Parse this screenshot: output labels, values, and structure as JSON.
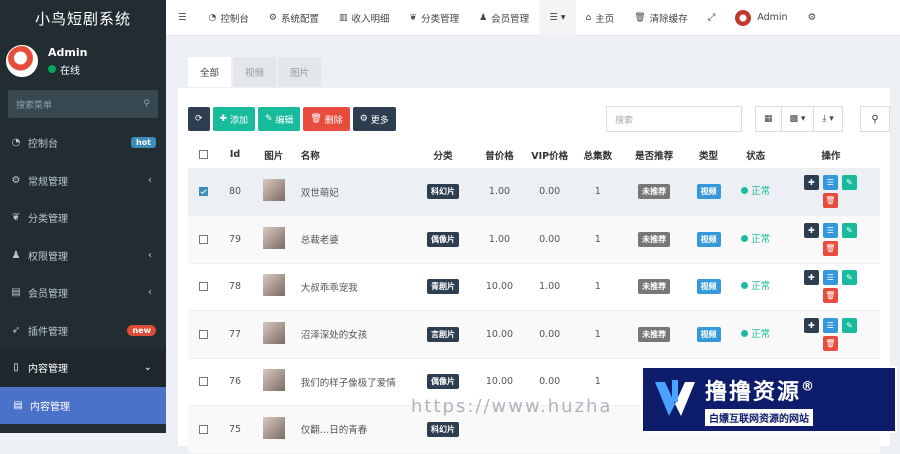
{
  "app": {
    "title": "小鸟短剧系统"
  },
  "user": {
    "name": "Admin",
    "status": "在线"
  },
  "sidebar": {
    "search_placeholder": "搜索菜单",
    "items": [
      {
        "label": "控制台",
        "badge": "hot"
      },
      {
        "label": "常规管理"
      },
      {
        "label": "分类管理"
      },
      {
        "label": "权限管理"
      },
      {
        "label": "会员管理"
      },
      {
        "label": "插件管理",
        "badge": "new"
      },
      {
        "label": "内容管理"
      },
      {
        "label": "内容管理"
      }
    ]
  },
  "topbar": {
    "items": [
      "控制台",
      "系统配置",
      "收入明细",
      "分类管理",
      "会员管理"
    ],
    "home": "主页",
    "clear_cache": "清除缓存",
    "admin": "Admin"
  },
  "tabs": [
    "全部",
    "视频",
    "图片"
  ],
  "toolbar": {
    "add": "添加",
    "edit": "编辑",
    "delete": "删除",
    "more": "更多",
    "search_placeholder": "搜索"
  },
  "table": {
    "headers": [
      "Id",
      "图片",
      "名称",
      "分类",
      "普价格",
      "VIP价格",
      "总集数",
      "是否推荐",
      "类型",
      "状态",
      "操作"
    ],
    "rows": [
      {
        "id": "80",
        "name": "双世萌妃",
        "category": "科幻片",
        "price": "1.00",
        "vip_price": "0.00",
        "episodes": "1",
        "recommend": "未推荐",
        "type": "视频",
        "status": "正常",
        "checked": true
      },
      {
        "id": "79",
        "name": "总裁老婆",
        "category": "偶像片",
        "price": "1.00",
        "vip_price": "0.00",
        "episodes": "1",
        "recommend": "未推荐",
        "type": "视频",
        "status": "正常",
        "checked": false
      },
      {
        "id": "78",
        "name": "大叔乖乖宠我",
        "category": "青剧片",
        "price": "10.00",
        "vip_price": "1.00",
        "episodes": "1",
        "recommend": "未推荐",
        "type": "视频",
        "status": "正常",
        "checked": false
      },
      {
        "id": "77",
        "name": "沼泽深处的女孩",
        "category": "言剧片",
        "price": "10.00",
        "vip_price": "0.00",
        "episodes": "1",
        "recommend": "未推荐",
        "type": "视频",
        "status": "正常",
        "checked": false
      },
      {
        "id": "76",
        "name": "我们的样子像极了爱情",
        "category": "偶像片",
        "price": "10.00",
        "vip_price": "0.00",
        "episodes": "1",
        "recommend": "",
        "type": "",
        "status": "",
        "checked": false
      },
      {
        "id": "75",
        "name": "仅翻…日的青春",
        "category": "科幻片",
        "price": "",
        "vip_price": "",
        "episodes": "",
        "recommend": "",
        "type": "",
        "status": "",
        "checked": false
      }
    ]
  },
  "watermark": {
    "url": "https://www.huzha",
    "brand_title": "撸撸资源",
    "brand_sub": "白嫖互联网资源的网站",
    "registered": "®"
  },
  "colors": {
    "sidebar": "#222d32",
    "accent": "#3c8dbc",
    "green": "#18bc9c",
    "red": "#e74c3c",
    "dark": "#2c3e50",
    "active": "#4b72c9"
  }
}
